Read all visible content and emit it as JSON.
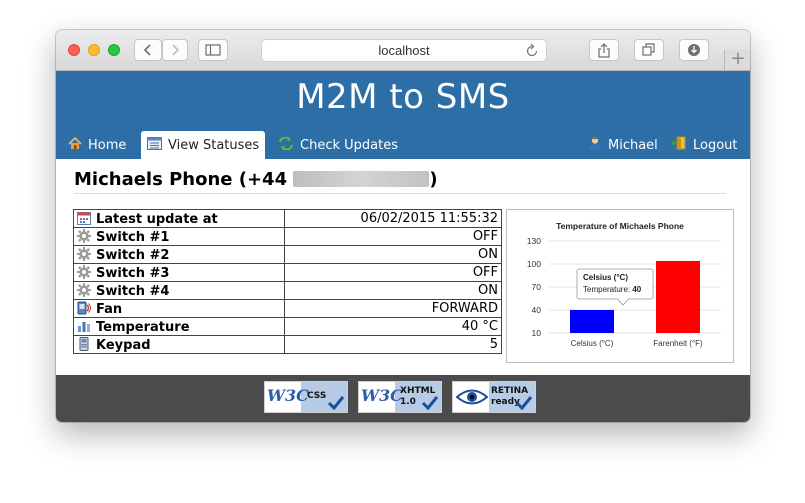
{
  "browser": {
    "url": "localhost"
  },
  "site": {
    "title": "M2M to SMS"
  },
  "nav": {
    "home": "Home",
    "view_statuses": "View Statuses",
    "check_updates": "Check Updates",
    "user": "Michael",
    "logout": "Logout"
  },
  "phone": {
    "title_prefix": "Michaels Phone (+44",
    "title_suffix": ")"
  },
  "status": {
    "rows": [
      {
        "label": "Latest update at",
        "value": "06/02/2015 11:55:32",
        "icon": "calendar-icon"
      },
      {
        "label": "Switch #1",
        "value": "OFF",
        "icon": "gear-icon"
      },
      {
        "label": "Switch #2",
        "value": "ON",
        "icon": "gear-icon"
      },
      {
        "label": "Switch #3",
        "value": "OFF",
        "icon": "gear-icon"
      },
      {
        "label": "Switch #4",
        "value": "ON",
        "icon": "gear-icon"
      },
      {
        "label": "Fan",
        "value": "FORWARD",
        "icon": "fan-icon"
      },
      {
        "label": "Temperature",
        "value": "40 °C",
        "icon": "bar-chart-icon"
      },
      {
        "label": "Keypad",
        "value": "5",
        "icon": "keypad-icon"
      }
    ]
  },
  "chart_data": {
    "type": "bar",
    "title": "Temperature of Michaels Phone",
    "categories": [
      "Celsius (°C)",
      "Farenheit (°F)"
    ],
    "values": [
      40,
      104
    ],
    "colors": [
      "#0000ff",
      "#ff0000"
    ],
    "yticks": [
      10,
      40,
      70,
      100,
      130
    ],
    "ylim": [
      10,
      130
    ],
    "grid": true,
    "tooltip": {
      "title": "Celsius (°C)",
      "label": "Temperature:",
      "value": "40"
    }
  },
  "footer": {
    "badges": [
      {
        "logo": "W3C",
        "text": "CSS"
      },
      {
        "logo": "W3C",
        "text": "XHTML",
        "sub": "1.0"
      },
      {
        "text": "RETINA",
        "sub": "ready"
      }
    ]
  }
}
